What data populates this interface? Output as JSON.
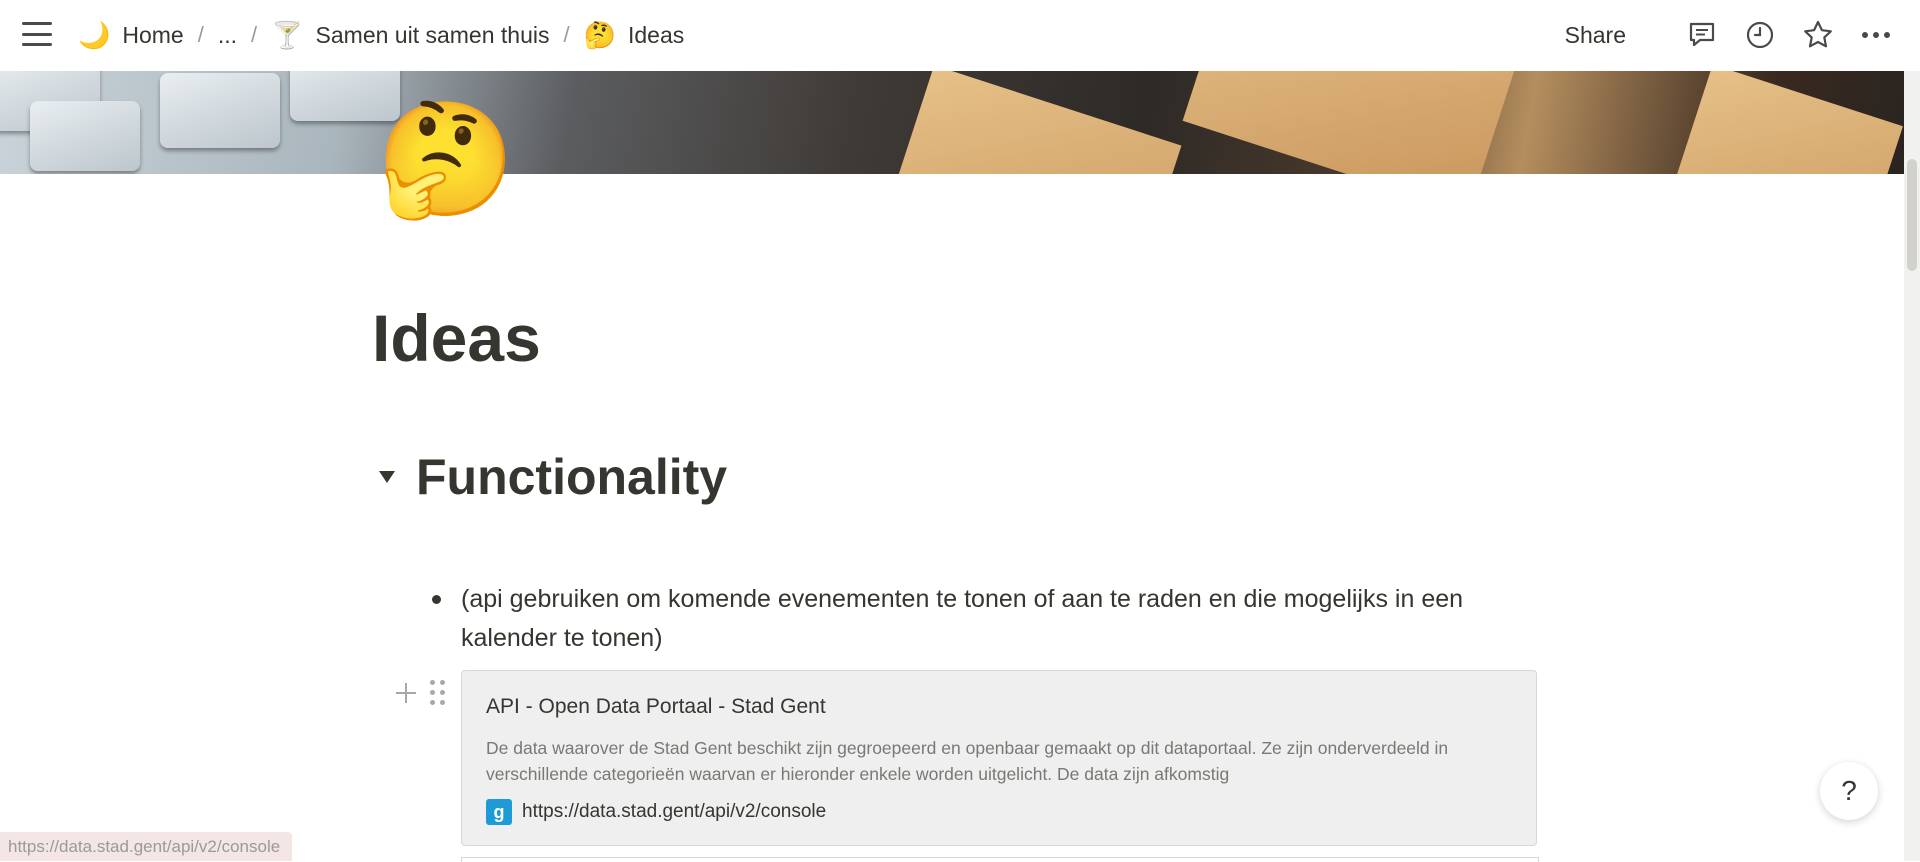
{
  "topbar": {
    "breadcrumbs": [
      {
        "emoji": "🌙",
        "label": "Home"
      },
      {
        "label": "..."
      },
      {
        "emoji": "🍸",
        "label": "Samen uit samen thuis"
      },
      {
        "emoji": "🤔",
        "label": "Ideas"
      }
    ],
    "separator": "/",
    "share_label": "Share",
    "icons": [
      "comments-icon",
      "clock-icon",
      "star-icon",
      "more-icon"
    ]
  },
  "page": {
    "icon": "🤔",
    "title": "Ideas"
  },
  "content": {
    "heading": "Functionality",
    "bullet": "(api gebruiken om komende evenementen te tonen of aan te raden en die mogelijks in een kalender te tonen)",
    "bookmark": {
      "title": "API - Open Data Portaal - Stad Gent",
      "description": "De data waarover de Stad Gent beschikt zijn gegroepeerd en openbaar gemaakt op dit dataportaal. Ze zijn onderverdeeld in verschillende categorieën waarvan er hieronder enkele worden uitgelicht. De data zijn afkomstig",
      "url": "https://data.stad.gent/api/v2/console",
      "favicon_glyph": "g"
    }
  },
  "status_bar": {
    "url": "https://data.stad.gent/api/v2/console"
  },
  "help_label": "?"
}
